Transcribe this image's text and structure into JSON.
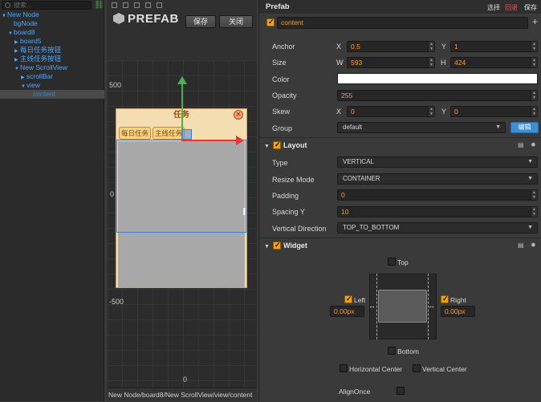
{
  "hierarchy": {
    "search_placeholder": "搜索...",
    "items": [
      {
        "label": "New Node",
        "arrow": "▼",
        "indent": 0
      },
      {
        "label": "bgNode",
        "arrow": "",
        "indent": 1
      },
      {
        "label": "board8",
        "arrow": "▼",
        "indent": 1
      },
      {
        "label": "board5",
        "arrow": "▶",
        "indent": 2
      },
      {
        "label": "每日任务按钮",
        "arrow": "▶",
        "indent": 2
      },
      {
        "label": "主线任务按钮",
        "arrow": "▶",
        "indent": 2
      },
      {
        "label": "New ScrollView",
        "arrow": "▼",
        "indent": 2
      },
      {
        "label": "scrollBar",
        "arrow": "▶",
        "indent": 3
      },
      {
        "label": "view",
        "arrow": "▼",
        "indent": 3
      },
      {
        "label": "content",
        "arrow": "",
        "indent": 4
      }
    ]
  },
  "scene": {
    "prefab_label": "PREFAB",
    "save_label": "保存",
    "close_label": "关闭",
    "tick_500": "500",
    "tick_0": "0",
    "tick_neg500": "-500",
    "tick_bottom": "0",
    "window_title": "任务",
    "window_close": "✕",
    "tab_daily": "每日任务",
    "tab_main": "主线任务",
    "status_path": "New Node/board8/New ScrollView/view/content"
  },
  "inspector": {
    "title": "Prefab",
    "btn_select": "选择",
    "btn_revert": "回退",
    "btn_save": "保存",
    "node_name": "content",
    "add_symbol": "+",
    "anchor": {
      "label": "Anchor",
      "x_axis": "X",
      "x": "0.5",
      "y_axis": "Y",
      "y": "1"
    },
    "size": {
      "label": "Size",
      "w_axis": "W",
      "w": "593",
      "h_axis": "H",
      "h": "424"
    },
    "color_label": "Color",
    "opacity": {
      "label": "Opacity",
      "value": "255"
    },
    "skew": {
      "label": "Skew",
      "x_axis": "X",
      "x": "0",
      "y_axis": "Y",
      "y": "0"
    },
    "group": {
      "label": "Group",
      "value": "default",
      "edit": "编辑"
    },
    "layout": {
      "title": "Layout",
      "type": {
        "label": "Type",
        "value": "VERTICAL"
      },
      "resize": {
        "label": "Resize Mode",
        "value": "CONTAINER"
      },
      "padding": {
        "label": "Padding",
        "value": "0"
      },
      "spacing": {
        "label": "Spacing Y",
        "value": "10"
      },
      "direction": {
        "label": "Vertical Direction",
        "value": "TOP_TO_BOTTOM"
      }
    },
    "widget": {
      "title": "Widget",
      "top": "Top",
      "left": "Left",
      "right": "Right",
      "bottom": "Bottom",
      "left_value": "0.00px",
      "right_value": "0.00px",
      "h_center": "Horizontal Center",
      "v_center": "Vertical Center",
      "align_once": "AlignOnce"
    }
  },
  "colors": {
    "accent_orange": "#f29f1a",
    "tree_blue": "#4aa8ff",
    "edit_button_blue": "#3d8fd6"
  }
}
